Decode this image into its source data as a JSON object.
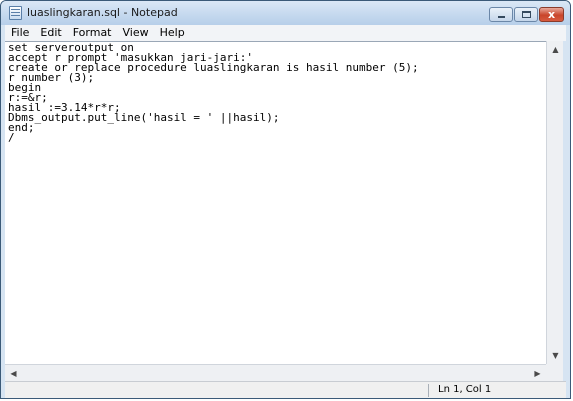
{
  "window": {
    "title": "luaslingkaran.sql - Notepad"
  },
  "menu": [
    "File",
    "Edit",
    "Format",
    "View",
    "Help"
  ],
  "editor": {
    "lines": [
      "set serveroutput on",
      "accept r prompt 'masukkan jari-jari:'",
      "create or replace procedure luaslingkaran is hasil number (5);",
      "r number (3);",
      "begin",
      "r:=&r;",
      "hasil :=3.14*r*r;",
      "Dbms_output.put_line('hasil = ' ||hasil);",
      "end;",
      "/"
    ]
  },
  "status": {
    "position": "Ln 1, Col 1"
  },
  "icons": {
    "scroll_up": "▲",
    "scroll_down": "▼",
    "scroll_left": "◀",
    "scroll_right": "▶",
    "close": "x"
  }
}
